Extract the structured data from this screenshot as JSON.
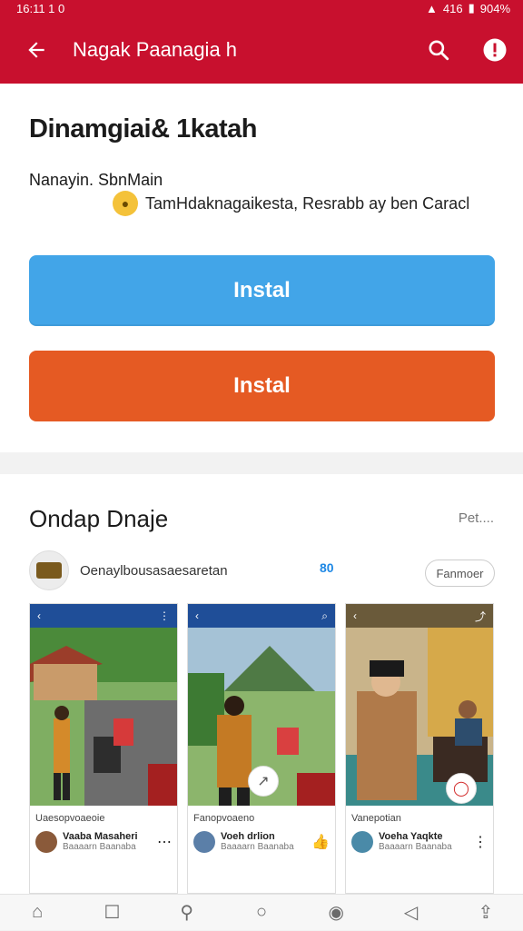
{
  "status_bar": {
    "time": "16:11 1 0",
    "network": "416",
    "battery": "904%"
  },
  "app_bar": {
    "title": "Nagak Paanagia h",
    "back_icon": "arrow-left-icon",
    "search_icon": "search-icon",
    "info_icon": "info-icon"
  },
  "header": {
    "title": "Dinamgiai& 1katah",
    "subtitle": "Nanayin. SbnMain",
    "note": "TamHdaknagaikesta, Resrabb ay ben Caracl",
    "note_icon": "emoji-icon"
  },
  "buttons": {
    "primary_label": "Instal",
    "secondary_label": "Instal",
    "primary_color": "#42a5e8",
    "secondary_color": "#e55a23"
  },
  "section": {
    "title": "Ondap Dnaje",
    "more": "Pet....",
    "profile_name": "Oenaylbousasaesaretan",
    "count": "80",
    "pill": "Fanmoer"
  },
  "shots": [
    {
      "caption": "Uaesopvoaeoie",
      "name": "Vaaba Masaheri",
      "line": "Baaaarn Baanaba"
    },
    {
      "caption": "Fanopvoaeno",
      "name": "Voeh drlion",
      "line": "Baaaarn Baanaba"
    },
    {
      "caption": "Vanepotian",
      "name": "Voeha Yaqkte",
      "line": "Baaaarn Baanaba"
    }
  ],
  "nav": [
    "home-icon",
    "square-icon",
    "search-icon",
    "circle-icon",
    "dot-icon",
    "back-triangle-icon",
    "share-icon"
  ],
  "brand_color": "#c8102e"
}
